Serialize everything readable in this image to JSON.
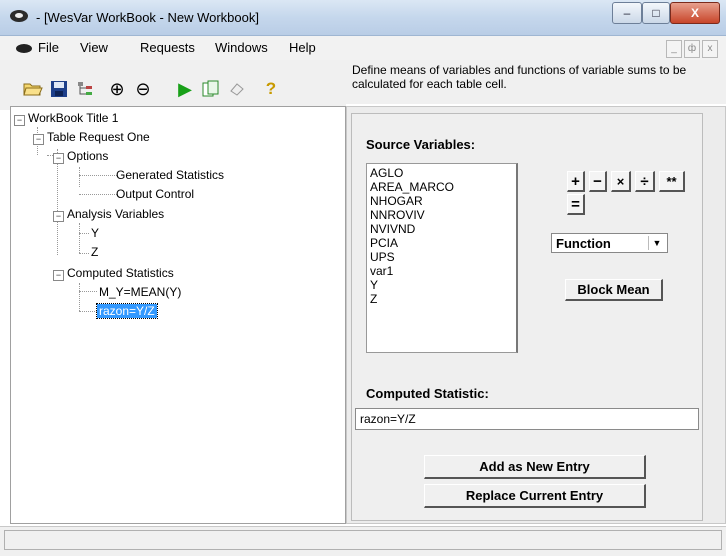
{
  "window": {
    "title": "- [WesVar WorkBook - New Workbook]"
  },
  "caption_buttons": {
    "minimize": "–",
    "maximize": "□",
    "close": "X"
  },
  "menu": [
    "File",
    "View",
    "Requests",
    "Windows",
    "Help"
  ],
  "mdi_buttons": [
    "_",
    "ф",
    "x"
  ],
  "toolbar_icons": [
    "open-folder-icon",
    "save-disk-icon",
    "tree-view-icon",
    "zoom-in-icon",
    "zoom-out-icon",
    "run-icon",
    "copy-results-icon",
    "eraser-icon",
    "help-icon"
  ],
  "toolbar_glyphs": {
    "zoom_in": "⊕",
    "zoom_out": "⊖",
    "run": "▶",
    "help": "?"
  },
  "description": "Define means of variables and functions of variable sums to be calculated for each table cell.",
  "tree": {
    "root": "WorkBook Title 1",
    "request": "Table Request One",
    "options": "Options",
    "generated_statistics": "Generated Statistics",
    "output_control": "Output Control",
    "analysis_variables": "Analysis Variables",
    "var_y": "Y",
    "var_z": "Z",
    "computed_statistics": "Computed Statistics",
    "stat_1": "M_Y=MEAN(Y)",
    "stat_2": "razon=Y/Z"
  },
  "expanders": {
    "collapse": "−"
  },
  "source_variables_label": "Source Variables:",
  "source_variables": [
    "AGLO",
    "AREA_MARCO",
    "NHOGAR",
    "NNROVIV",
    "NVIVND",
    "PCIA",
    "UPS",
    "var1",
    "Y",
    "Z"
  ],
  "operators": [
    "+",
    "−",
    "×",
    "÷",
    "**",
    "="
  ],
  "function_select": {
    "selected": "Function",
    "arrow": "▼"
  },
  "block_mean_label": "Block Mean",
  "computed_statistic_label": "Computed Statistic:",
  "computed_statistic_value": "razon=Y/Z",
  "add_button": "Add as New Entry",
  "replace_button": "Replace Current Entry"
}
